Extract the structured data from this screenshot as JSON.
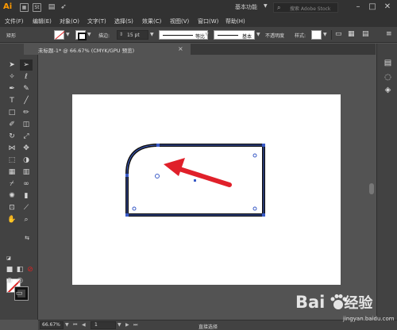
{
  "app": {
    "logo": "Ai",
    "bridge_label": "St",
    "workspace": "基本功能",
    "search_placeholder": "搜索 Adobe Stock"
  },
  "menu": [
    {
      "label": "文件(F)"
    },
    {
      "label": "编辑(E)"
    },
    {
      "label": "对象(O)"
    },
    {
      "label": "文字(T)"
    },
    {
      "label": "选择(S)"
    },
    {
      "label": "效果(C)"
    },
    {
      "label": "视图(V)"
    },
    {
      "label": "窗口(W)"
    },
    {
      "label": "帮助(H)"
    }
  ],
  "controlbar": {
    "object_type": "矩形",
    "stroke_label": "描边:",
    "stroke_weight": "15 pt",
    "profile_label": "等比",
    "brush_label": "基本",
    "opacity_label": "不透明度",
    "style_label": "样式:"
  },
  "document": {
    "tab_title": "未标题-1* @ 66.67% (CMYK/GPU 预览)",
    "close_glyph": "×"
  },
  "statusbar": {
    "zoom": "66.67%",
    "artboard_number": "1",
    "status": "直接选择"
  },
  "watermark": {
    "text": "Bai",
    "text2": "经验",
    "sub": "jingyan.baidu.com"
  },
  "colors": {
    "shape_stroke": "#1a1a3a",
    "anchor": "#3a5bc7",
    "arrow": "#e0202a"
  }
}
